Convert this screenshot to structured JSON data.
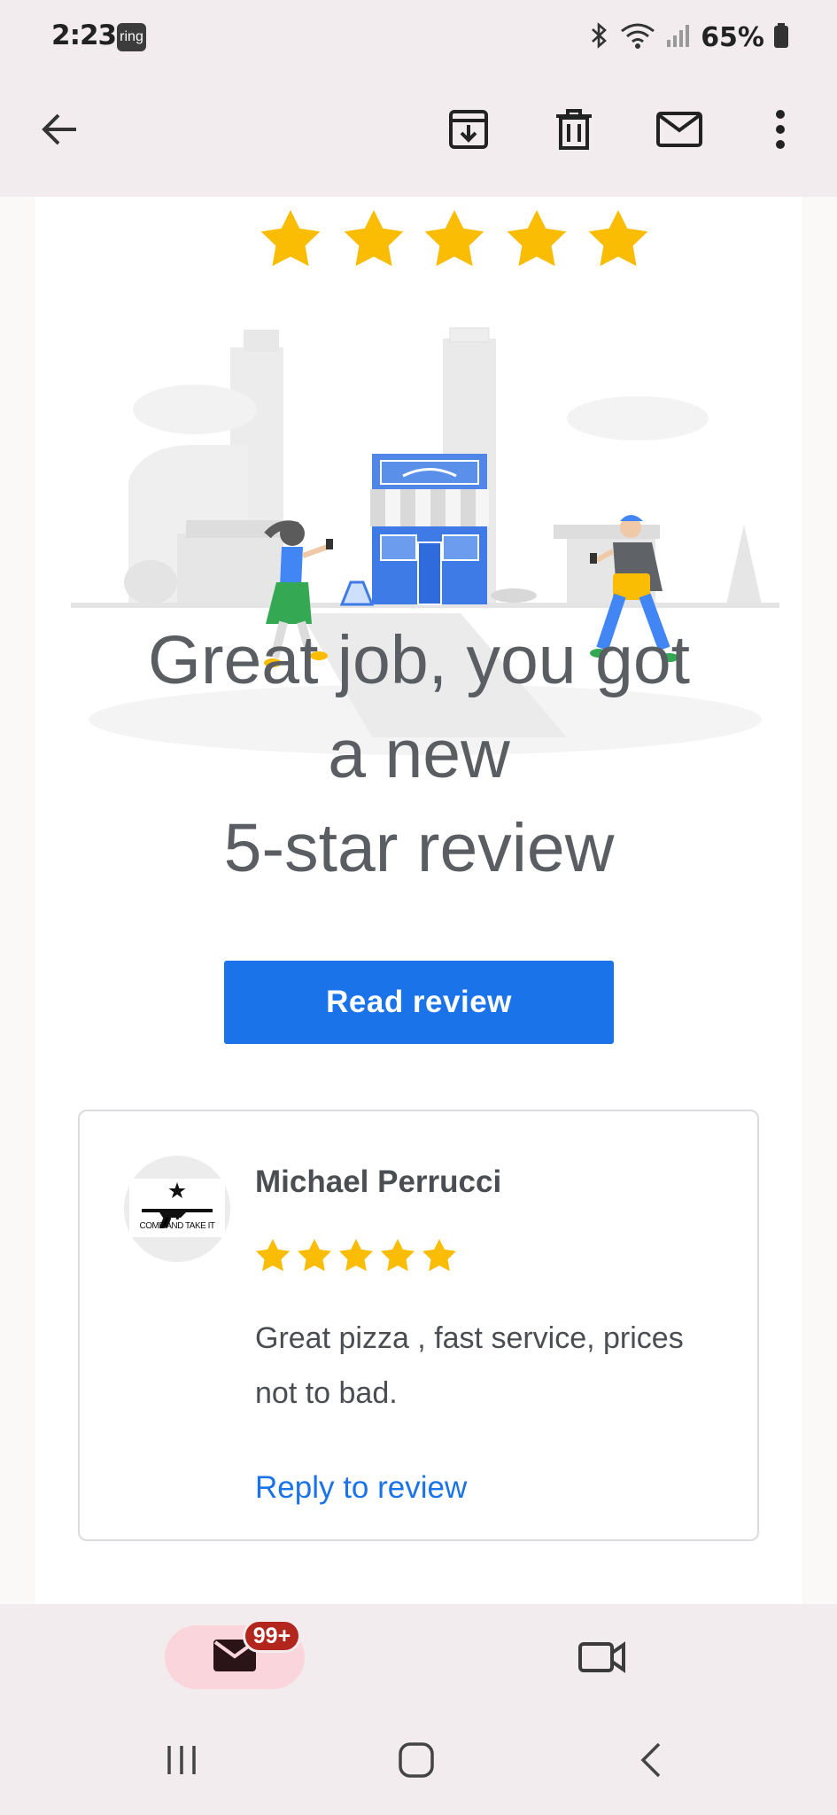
{
  "status_bar": {
    "time": "2:23",
    "ring_label": "ring",
    "battery": "65%"
  },
  "app_bar": {
    "icons": [
      "back-arrow-icon",
      "archive-icon",
      "delete-icon",
      "mark-unread-icon",
      "more-vert-icon"
    ]
  },
  "email": {
    "top_star_count": 5,
    "headline": {
      "line1": "Great job, you got",
      "line2": "a new",
      "line3": "5-star review"
    },
    "read_review_label": "Read review",
    "review": {
      "avatar_text": "COME AND TAKE IT",
      "reviewer_name": "Michael Perrucci",
      "star_count": 5,
      "text": "Great pizza , fast service, prices not to bad.",
      "reply_label": "Reply to review"
    }
  },
  "bottom_nav": {
    "mail_badge": "99+"
  },
  "colors": {
    "accent": "#1a73e8",
    "star": "#fbbc04",
    "badge": "#b3261e",
    "pill": "#fbd5dc"
  }
}
